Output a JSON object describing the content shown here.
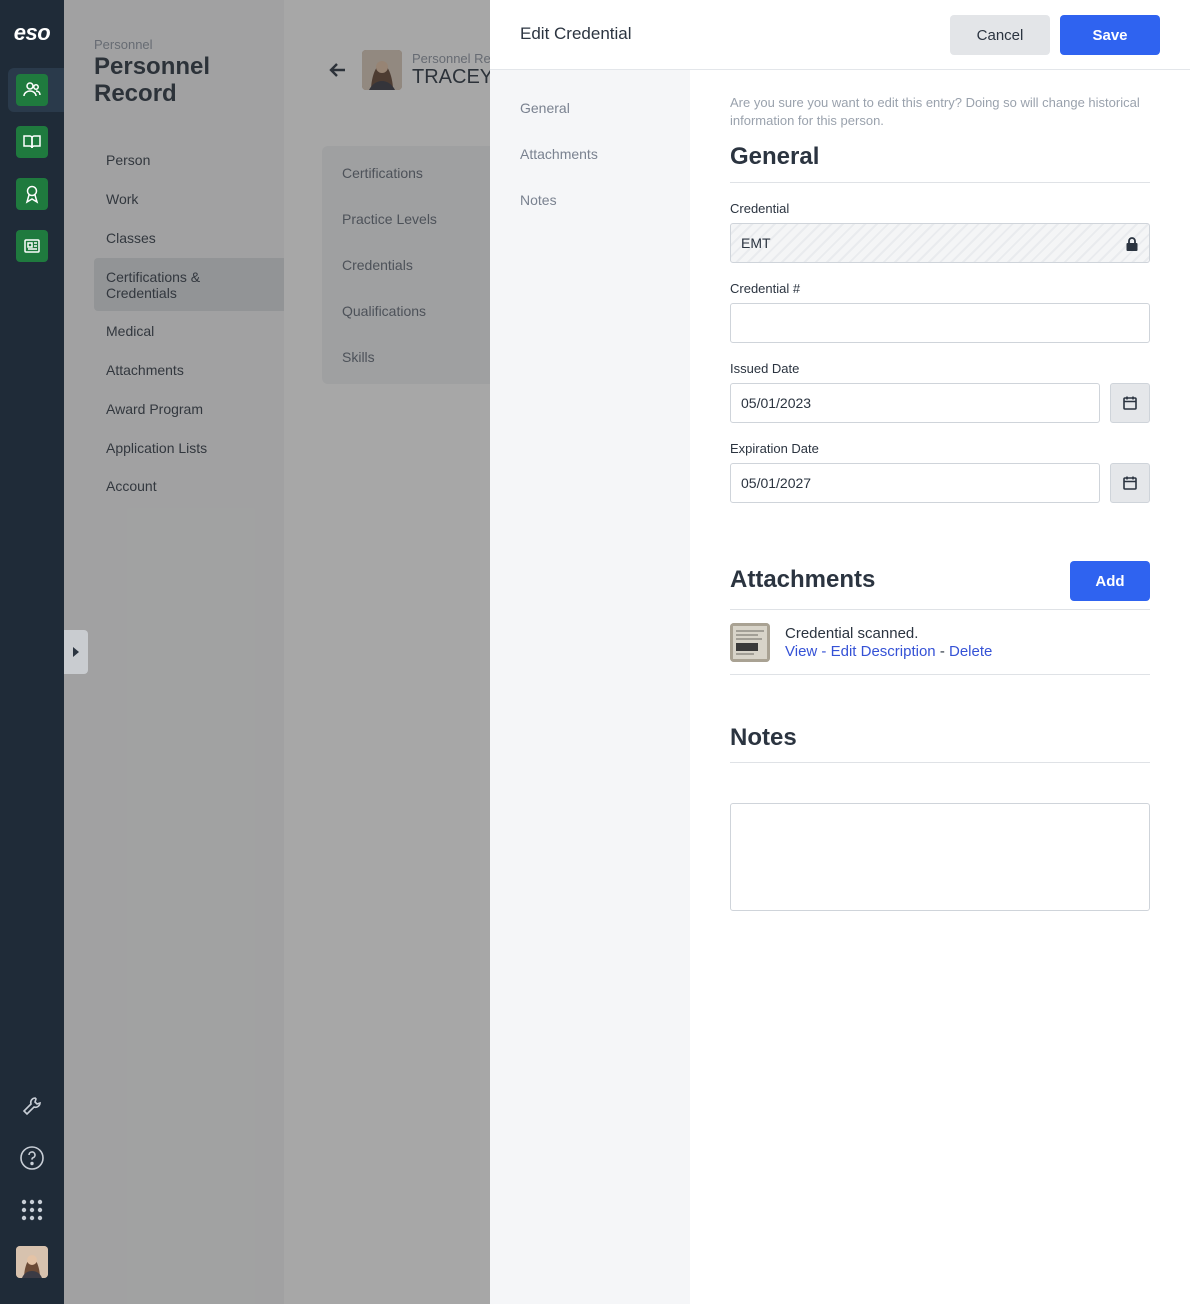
{
  "rail": {
    "logo": "eso",
    "icons": [
      "people-icon",
      "book-icon",
      "award-icon",
      "news-icon"
    ],
    "bottom_icons": [
      "wrench-icon",
      "help-icon",
      "apps-grid-icon"
    ],
    "accent_color": "#1f7a3e"
  },
  "nav": {
    "eyebrow": "Personnel",
    "title": "Personnel Record",
    "items": [
      {
        "label": "Person"
      },
      {
        "label": "Work"
      },
      {
        "label": "Classes"
      },
      {
        "label": "Certifications & Credentials",
        "active": true
      },
      {
        "label": "Medical"
      },
      {
        "label": "Attachments"
      },
      {
        "label": "Award Program"
      },
      {
        "label": "Application Lists"
      },
      {
        "label": "Account"
      }
    ]
  },
  "person": {
    "eyebrow": "Personnel Rec",
    "name": "TRACEY"
  },
  "subnav": {
    "items": [
      "Certifications",
      "Practice Levels",
      "Credentials",
      "Qualifications",
      "Skills"
    ]
  },
  "drawer": {
    "title": "Edit Credential",
    "cancel_label": "Cancel",
    "save_label": "Save",
    "side_items": [
      "General",
      "Attachments",
      "Notes"
    ],
    "warning": "Are you sure you want to edit this entry? Doing so will change historical information for this person.",
    "general": {
      "title": "General",
      "credential_label": "Credential",
      "credential_value": "EMT",
      "credential_number_label": "Credential #",
      "credential_number_value": "",
      "issued_label": "Issued Date",
      "issued_value": "05/01/2023",
      "expiration_label": "Expiration Date",
      "expiration_value": "05/01/2027"
    },
    "attachments": {
      "title": "Attachments",
      "add_label": "Add",
      "items": [
        {
          "description": "Credential scanned.",
          "view_label": "View",
          "edit_label": "Edit Description",
          "delete_label": "Delete"
        }
      ],
      "separator": "-"
    },
    "notes": {
      "title": "Notes",
      "value": ""
    }
  },
  "colors": {
    "primary": "#2f63f0",
    "link": "#3552d6",
    "rail_bg": "#1f2b38"
  }
}
